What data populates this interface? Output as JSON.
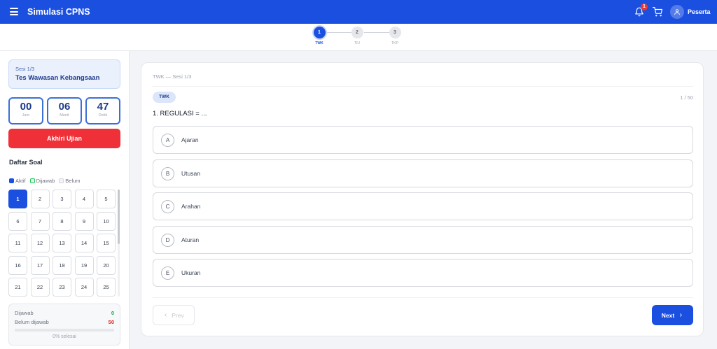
{
  "header": {
    "menu_icon": "hamburger-icon",
    "title": "Simulasi CPNS",
    "notification_icon": "bell-icon",
    "notification_count": "1",
    "cart_icon": "cart-icon",
    "user_icon": "user-icon",
    "user_name": "Peserta"
  },
  "stepper": {
    "steps": [
      {
        "number": "1",
        "label": "TWK",
        "active": true
      },
      {
        "number": "2",
        "label": "TIU",
        "active": false
      },
      {
        "number": "3",
        "label": "TKP",
        "active": false
      }
    ]
  },
  "sidebar": {
    "session_label": "Sesi 1/3",
    "session_name": "Tes Wawasan Kebangsaan",
    "timer": [
      {
        "value": "00",
        "label": "Jam"
      },
      {
        "value": "06",
        "label": "Menit"
      },
      {
        "value": "47",
        "label": "Detik"
      }
    ],
    "end_button": "Akhiri Ujian",
    "list_title": "Daftar Soal",
    "legend": [
      {
        "label": "Aktif",
        "color": "#1b4fe0"
      },
      {
        "label": "Dijawab",
        "color": "#22c55e"
      },
      {
        "label": "Belum",
        "color": "#d1d5db"
      }
    ],
    "questions": [
      "1",
      "2",
      "3",
      "4",
      "5",
      "6",
      "7",
      "8",
      "9",
      "10",
      "11",
      "12",
      "13",
      "14",
      "15",
      "16",
      "17",
      "18",
      "19",
      "20",
      "21",
      "22",
      "23",
      "24",
      "25"
    ],
    "active_question": "1",
    "summary": {
      "answered_label": "Dijawab",
      "answered_value": "0",
      "unanswered_label": "Belum dijawab",
      "unanswered_value": "50",
      "progress_fraction": 0,
      "progress_text": "0% selesai"
    }
  },
  "main": {
    "breadcrumb": "TWK — Sesi 1/3",
    "tag": "TWK",
    "counter": "1 / 50",
    "question": "1. REGULASI = ...",
    "options": [
      {
        "letter": "A",
        "text": "Ajaran"
      },
      {
        "letter": "B",
        "text": "Utusan"
      },
      {
        "letter": "C",
        "text": "Arahan"
      },
      {
        "letter": "D",
        "text": "Aturan"
      },
      {
        "letter": "E",
        "text": "Ukuran"
      }
    ],
    "prev_label": "Prev",
    "next_label": "Next",
    "prev_icon": "chevron-left-icon",
    "next_icon": "chevron-right-icon"
  },
  "colors": {
    "primary": "#1b4fe0",
    "danger": "#f03038",
    "success": "#16a34a"
  }
}
